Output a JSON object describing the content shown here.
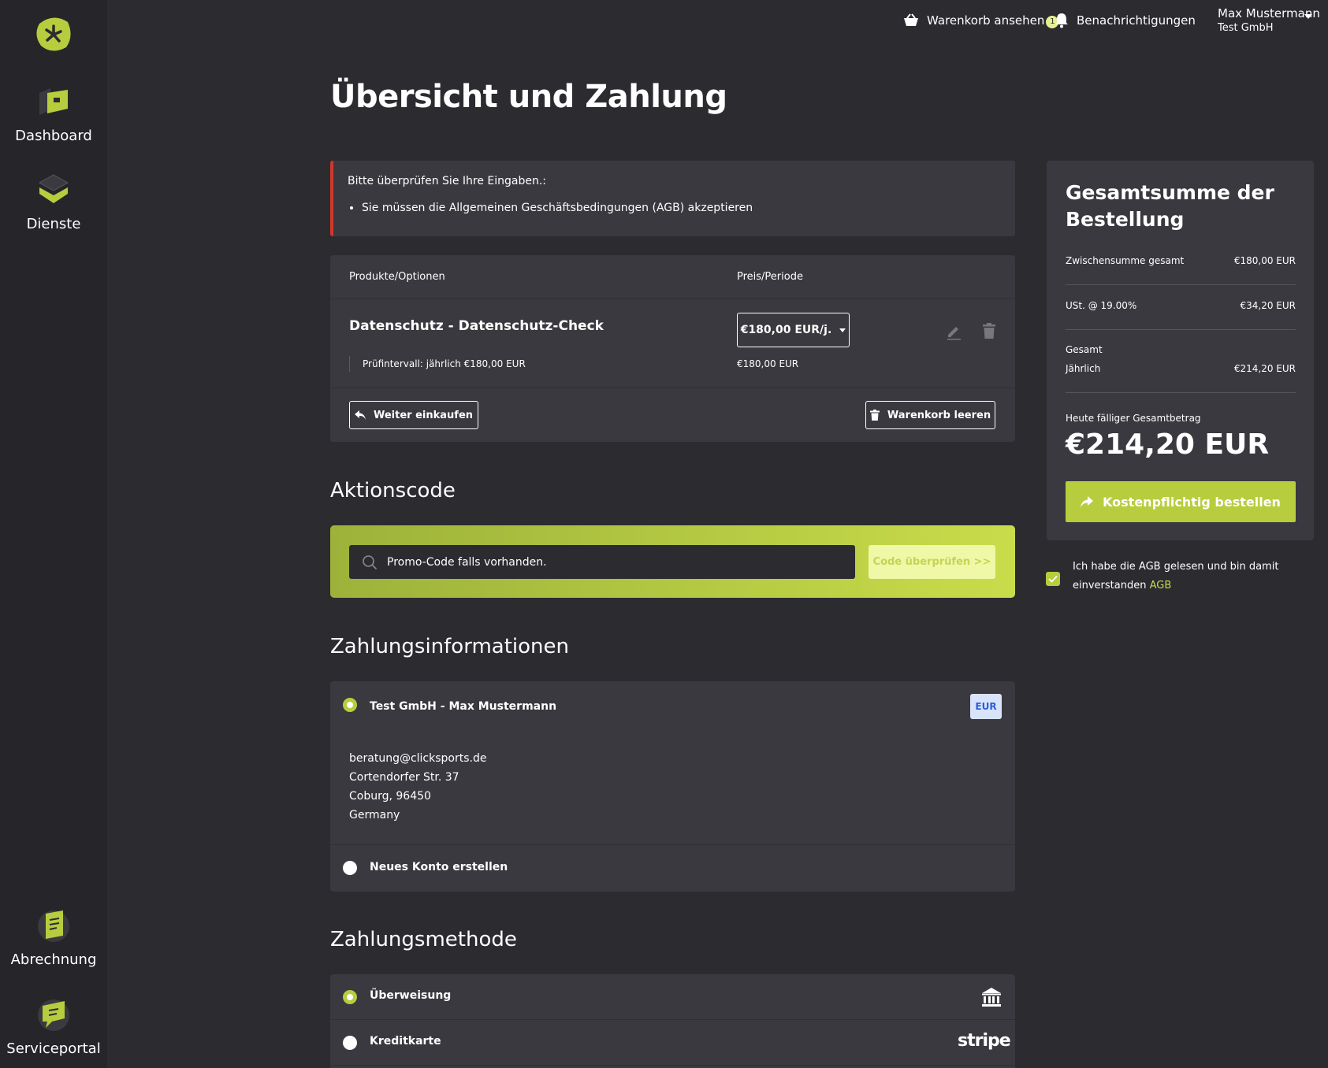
{
  "sidebar": {
    "items": [
      {
        "label": "Dashboard",
        "icon": "dashboard-icon"
      },
      {
        "label": "Dienste",
        "icon": "services-icon"
      },
      {
        "label": "Abrechnung",
        "icon": "billing-icon"
      },
      {
        "label": "Serviceportal",
        "icon": "support-icon"
      }
    ]
  },
  "topbar": {
    "cart_label": "Warenkorb ansehen",
    "cart_count": "1",
    "notifications_label": "Benachrichtigungen",
    "user_name": "Max Mustermann",
    "user_company": "Test GmbH"
  },
  "page": {
    "title": "Übersicht und Zahlung"
  },
  "alert": {
    "title": "Bitte überprüfen Sie Ihre Eingaben.:",
    "items": [
      "Sie müssen die Allgemeinen Geschäftsbedingungen (AGB) akzeptieren"
    ]
  },
  "cart": {
    "col_product": "Produkte/Optionen",
    "col_price": "Preis/Periode",
    "product_name": "Datenschutz - Datenschutz-Check",
    "product_option": "Prüfintervall: jährlich €180,00 EUR",
    "price_select": "€180,00 EUR/j.",
    "price_sub": "€180,00 EUR",
    "continue_label": "Weiter einkaufen",
    "empty_label": "Warenkorb leeren"
  },
  "promo": {
    "title": "Aktionscode",
    "placeholder": "Promo-Code falls vorhanden.",
    "button": "Code überprüfen >>"
  },
  "payinfo": {
    "title": "Zahlungsinformationen",
    "account_name": "Test GmbH - Max Mustermann",
    "currency": "EUR",
    "email": "beratung@clicksports.de",
    "street": "Cortendorfer Str. 37",
    "city": "Coburg, 96450",
    "country": "Germany",
    "new_account": "Neues Konto erstellen"
  },
  "paymethod": {
    "title": "Zahlungsmethode",
    "transfer": "Überweisung",
    "card": "Kreditkarte",
    "card_brand": "stripe"
  },
  "summary": {
    "title": "Gesamtsumme der Bestellung",
    "subtotal_label": "Zwischensumme gesamt",
    "subtotal_value": "€180,00 EUR",
    "vat_label": "USt. @ 19.00%",
    "vat_value": "€34,20 EUR",
    "total_label": "Gesamt",
    "period_label": "Jährlich",
    "period_value": "€214,20 EUR",
    "due_label": "Heute fälliger Gesamtbetrag",
    "due_amount": "€214,20 EUR",
    "order_button": "Kostenpflichtig bestellen"
  },
  "agb": {
    "text": "Ich habe die AGB gelesen und bin damit einverstanden",
    "link": "AGB"
  },
  "colors": {
    "accent": "#b7cd3e",
    "background": "#2b2b30",
    "panel": "#39393f",
    "error": "#d0382b"
  }
}
